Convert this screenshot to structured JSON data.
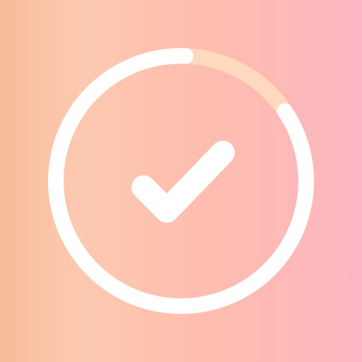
{
  "icon": {
    "name": "task-complete-app-icon",
    "symbol": "check-icon",
    "progress_ring": {
      "progress_fraction": 0.85,
      "ring_color": "#ffffff",
      "remaining_color": "#fed9bd"
    },
    "check_color": "#ffffff",
    "background": {
      "gradient_start": "#f6bd9b",
      "gradient_end": "#fdb6c3"
    }
  }
}
